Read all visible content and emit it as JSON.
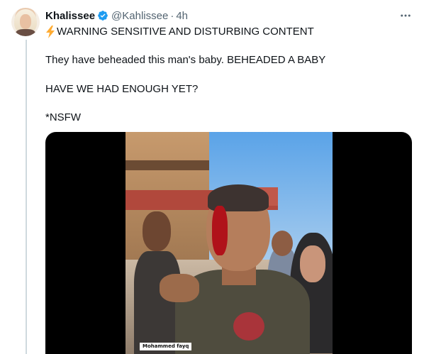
{
  "tweet": {
    "author_name": "Khalissee",
    "handle": "@Kahlissee",
    "separator": "·",
    "time": "4h",
    "lines": [
      "WARNING SENSITIVE AND DISTURBING CONTENT",
      "They have beheaded this man's baby. BEHEADED A BABY",
      "HAVE WE HAD ENOUGH YET?",
      "*NSFW"
    ],
    "media_caption": "Mohammed fayq"
  },
  "icons": {
    "more": "more-horizontal-icon",
    "verified": "verified-badge-icon",
    "warning": "high-voltage-emoji-icon"
  },
  "colors": {
    "verified_blue": "#1d9bf0",
    "text": "#0f1419",
    "muted": "#536471"
  }
}
